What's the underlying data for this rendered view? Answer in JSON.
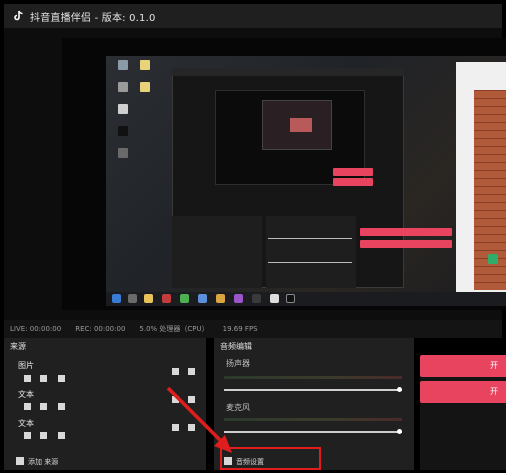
{
  "window": {
    "title": "抖音直播伴侣 - 版本: 0.1.0"
  },
  "status": {
    "live_time": "LIVE: 00:00:00",
    "rec_time": "REC: 00:00:00",
    "cpu": "5.0% 处理器（CPU）",
    "fps": "19.69 FPS"
  },
  "sources_panel": {
    "header": "来源",
    "groups": [
      {
        "label": "图片"
      },
      {
        "label": "文本"
      },
      {
        "label": "文本"
      }
    ],
    "add_label": "添加 来源"
  },
  "mixer_panel": {
    "header": "音频编辑",
    "channels": [
      {
        "label": "扬声器",
        "volume": 1.0
      },
      {
        "label": "麦克风",
        "volume": 1.0
      }
    ],
    "settings_label": "音频设置"
  },
  "actions": {
    "first_btn_label": "开",
    "second_btn_label": "开"
  },
  "colors": {
    "accent": "#e8435f",
    "highlight": "#e01d1d",
    "panel_bg": "#202020"
  },
  "icons": {
    "app": "tiktok-icon"
  }
}
